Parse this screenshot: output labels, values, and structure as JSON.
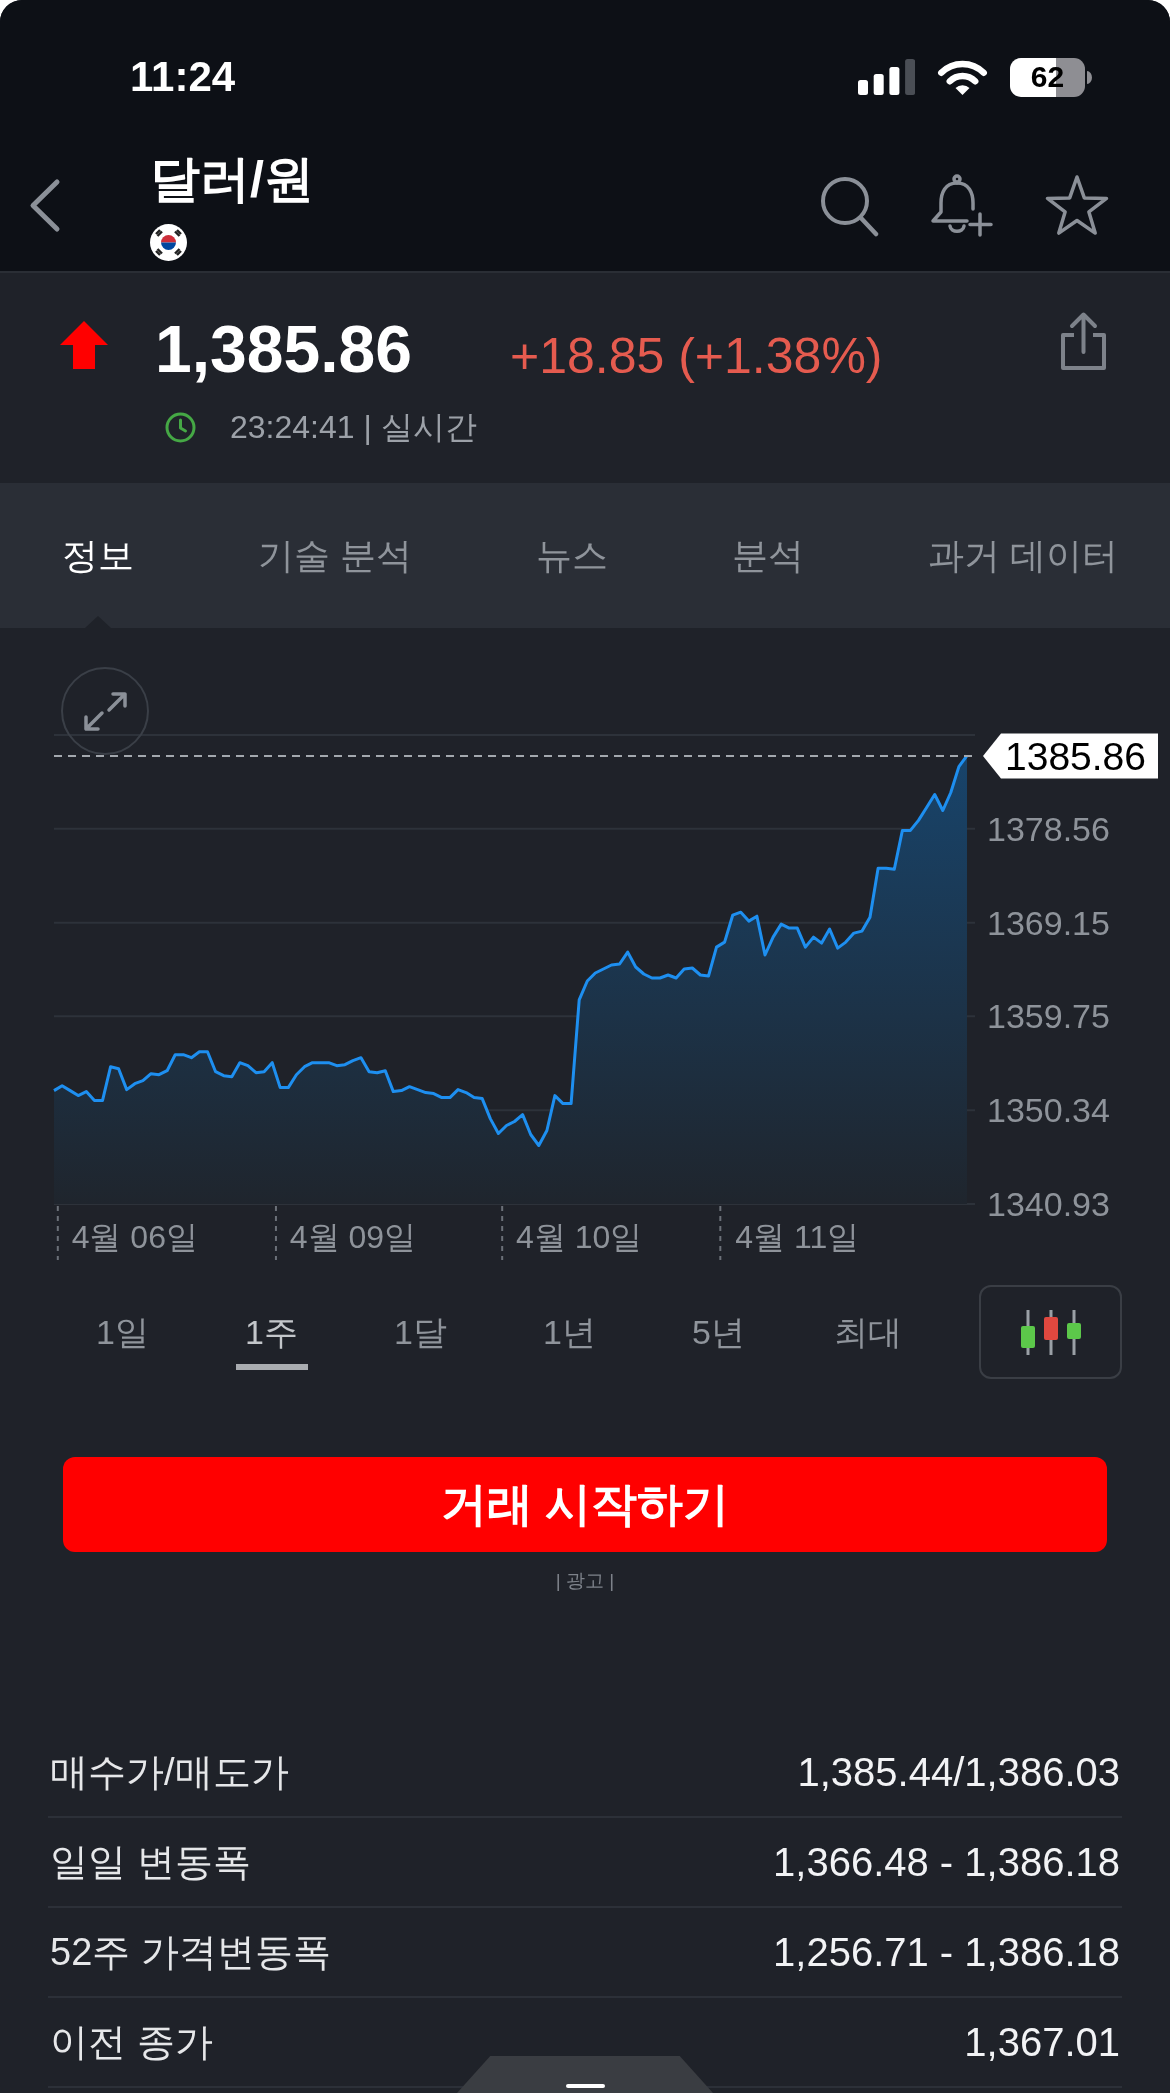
{
  "status_bar": {
    "time": "11:24",
    "battery": "62"
  },
  "header": {
    "title": "달러/원"
  },
  "quote": {
    "rising": true,
    "price": "1,385.86",
    "change": "+18.85 (+1.38%)",
    "time": "23:24:41 | 실시간"
  },
  "tabs": [
    {
      "label": "정보",
      "selected": true
    },
    {
      "label": "기술 분석",
      "selected": false
    },
    {
      "label": "뉴스",
      "selected": false
    },
    {
      "label": "분석",
      "selected": false
    },
    {
      "label": "과거 데이터",
      "selected": false
    }
  ],
  "chart": {
    "chart_data": {
      "type": "area",
      "categories": [
        null,
        null,
        null,
        null,
        null,
        null,
        null,
        null,
        null,
        null,
        "4월 06일",
        null,
        null,
        null,
        null,
        null,
        null,
        null,
        null,
        null,
        null,
        null,
        null,
        null,
        null,
        null,
        null,
        null,
        null,
        null,
        null,
        null,
        null,
        null,
        null,
        null,
        null,
        "4월 09일",
        null,
        null,
        null,
        null,
        null,
        null,
        null,
        null,
        null,
        null,
        null,
        null,
        null,
        null,
        null,
        null,
        null,
        null,
        null,
        null,
        null,
        null,
        null,
        null,
        null,
        null,
        null,
        "4월 10일",
        null,
        null,
        null,
        null,
        null,
        null,
        null,
        null,
        null,
        null,
        null,
        null,
        null,
        null,
        null,
        null,
        null,
        null,
        null,
        null,
        null,
        null,
        null,
        null,
        null,
        null,
        "4월 11일",
        null,
        null,
        null,
        null,
        null,
        null,
        null,
        null,
        null,
        null,
        null,
        null,
        null,
        null,
        null,
        null,
        null,
        null,
        null,
        null,
        null
      ],
      "series": [
        {
          "color": "#1e8ff0",
          "values": [
            1352.3,
            1352.8,
            1352.3,
            1351.8,
            1352.2,
            1351.3,
            1351.3,
            1354.7,
            1354.5,
            1352.4,
            1353.0,
            1353.3,
            1354.0,
            1353.9,
            1354.3,
            1355.9,
            1355.9,
            1355.6,
            1356.2,
            1356.2,
            1354.2,
            1353.8,
            1353.7,
            1355.1,
            1354.8,
            1354.1,
            1354.2,
            1355.1,
            1352.6,
            1352.6,
            1353.9,
            1354.7,
            1355.1,
            1355.1,
            1355.1,
            1354.8,
            1354.9,
            1355.3,
            1355.6,
            1354.2,
            1354.1,
            1354.3,
            1352.2,
            1352.3,
            1352.7,
            1352.4,
            1352.1,
            1352.0,
            1351.6,
            1351.6,
            1352.4,
            1352.1,
            1351.6,
            1351.5,
            1349.5,
            1348.0,
            1348.8,
            1349.2,
            1349.9,
            1347.9,
            1346.8,
            1348.3,
            1351.8,
            1351.0,
            1351.0,
            1361.4,
            1363.3,
            1364.1,
            1364.5,
            1364.9,
            1365.0,
            1366.2,
            1364.7,
            1364.0,
            1363.6,
            1363.6,
            1363.9,
            1363.6,
            1364.5,
            1364.6,
            1363.9,
            1363.8,
            1366.7,
            1367.2,
            1369.9,
            1370.2,
            1369.3,
            1369.8,
            1365.9,
            1367.7,
            1369.0,
            1368.6,
            1368.6,
            1366.7,
            1367.7,
            1367.1,
            1368.5,
            1366.6,
            1367.2,
            1368.1,
            1368.3,
            1369.7,
            1374.6,
            1374.6,
            1374.5,
            1378.4,
            1378.4,
            1379.4,
            1380.7,
            1382.0,
            1380.4,
            1382.2,
            1384.8,
            1385.9
          ]
        }
      ],
      "ylim": [
        1340.93,
        1387.97
      ],
      "yticks": [
        1340.93,
        1350.34,
        1359.75,
        1369.15,
        1378.56
      ],
      "grid": true,
      "ref_lines": [
        {
          "axis": "y",
          "value": 1385.86,
          "label": "1385.86"
        }
      ]
    }
  },
  "ranges": [
    {
      "label": "1일",
      "selected": false
    },
    {
      "label": "1주",
      "selected": true
    },
    {
      "label": "1달",
      "selected": false
    },
    {
      "label": "1년",
      "selected": false
    },
    {
      "label": "5년",
      "selected": false
    },
    {
      "label": "최대",
      "selected": false
    }
  ],
  "trade": {
    "label": "거래 시작하기",
    "ad_label": "| 광고 |"
  },
  "stats": [
    {
      "label": "매수가/매도가",
      "value": "1,385.44/1,386.03"
    },
    {
      "label": "일일 변동폭",
      "value": "1,366.48 - 1,386.18"
    },
    {
      "label": "52주 가격변동폭",
      "value": "1,256.71 - 1,386.18"
    },
    {
      "label": "이전 종가",
      "value": "1,367.01"
    }
  ]
}
